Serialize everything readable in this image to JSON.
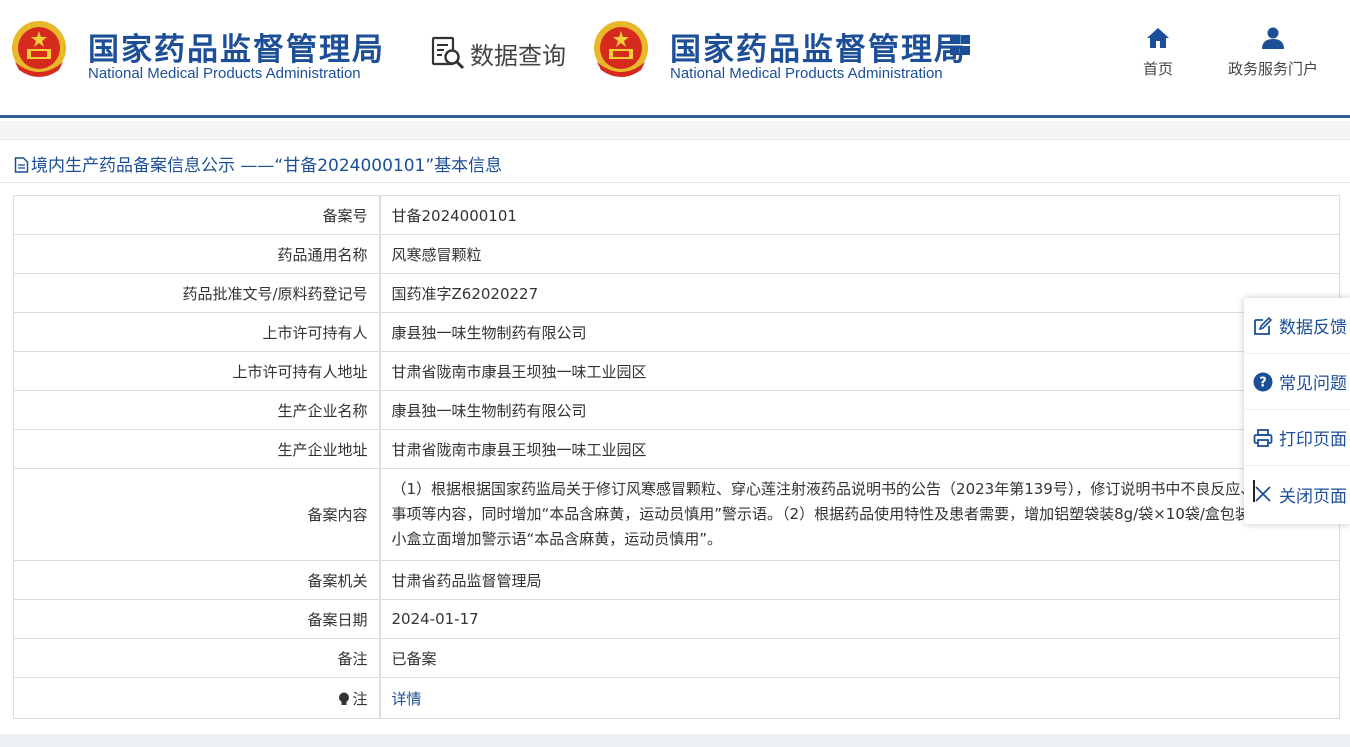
{
  "header": {
    "brand_left": {
      "cn": "国家药品监督管理局",
      "en": "National Medical Products Administration"
    },
    "search_label": "数据查询",
    "brand_right": {
      "cn": "国家药品监督管理局",
      "en": "National Medical Products Administration"
    },
    "nav": [
      {
        "label": "首页",
        "icon": "home-icon"
      },
      {
        "label": "政务服务门户",
        "icon": "user-icon"
      }
    ],
    "accent_color": "#1d4f98"
  },
  "section": {
    "title": "境内生产药品备案信息公示 ——“甘备2024000101”基本信息"
  },
  "record": {
    "rows": [
      {
        "label": "备案号",
        "value": "甘备2024000101"
      },
      {
        "label": "药品通用名称",
        "value": "风寒感冒颗粒"
      },
      {
        "label": "药品批准文号/原料药登记号",
        "value": "国药准字Z62020227"
      },
      {
        "label": "上市许可持有人",
        "value": "康县独一味生物制药有限公司"
      },
      {
        "label": "上市许可持有人地址",
        "value": "甘肃省陇南市康县王坝独一味工业园区"
      },
      {
        "label": "生产企业名称",
        "value": "康县独一味生物制药有限公司"
      },
      {
        "label": "生产企业地址",
        "value": "甘肃省陇南市康县王坝独一味工业园区"
      },
      {
        "label": "备案内容",
        "value": "（1）根据根据国家药监局关于修订风寒感冒颗粒、穿心莲注射液药品说明书的公告（2023年第139号），修订说明书中不良反应、禁忌、注意事项等内容，同时增加“本品含麻黄，运动员慎用”警示语。（2）根据药品使用特性及患者需要，增加铝塑袋装8g/袋×10袋/盒包装规格，同时小盒立面增加警示语“本品含麻黄，运动员慎用”。"
      },
      {
        "label": "备案机关",
        "value": "甘肃省药品监督管理局"
      },
      {
        "label": "备案日期",
        "value": "2024-01-17"
      },
      {
        "label": "备注",
        "value": "已备案"
      }
    ],
    "note_label": "注",
    "note_link": "详情"
  },
  "float_tools": [
    {
      "label": "数据反馈",
      "icon": "edit-icon"
    },
    {
      "label": "常见问题",
      "icon": "question-icon"
    },
    {
      "label": "打印页面",
      "icon": "print-icon"
    },
    {
      "label": "关闭页面",
      "icon": "close-icon"
    }
  ]
}
